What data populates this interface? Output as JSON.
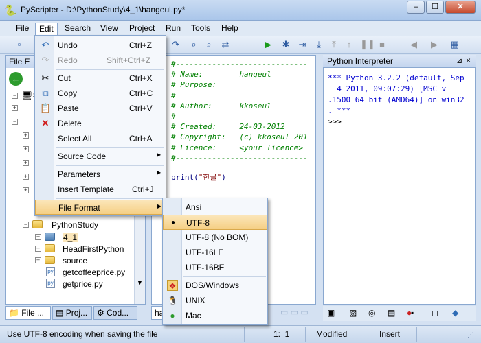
{
  "window": {
    "title": "PyScripter - D:\\PythonStudy\\4_1\\hangeul.py*",
    "min": "–",
    "max": "☐",
    "close": "✕"
  },
  "menubar": [
    "File",
    "Edit",
    "Search",
    "View",
    "Project",
    "Run",
    "Tools",
    "Help"
  ],
  "explorer": {
    "title": "File E",
    "tree_top": "컴",
    "folder": "PythonStudy",
    "items": [
      {
        "label": "4_1",
        "type": "folder"
      },
      {
        "label": "HeadFirstPython",
        "type": "folder"
      },
      {
        "label": "source",
        "type": "folder"
      },
      {
        "label": "getcoffeeprice.py",
        "type": "py"
      },
      {
        "label": "getprice.py",
        "type": "py"
      }
    ]
  },
  "bottom_tabs": [
    "File ...",
    "Proj...",
    "Cod..."
  ],
  "editor": {
    "tab": "han",
    "lines": [
      "#-----------------------------",
      "# Name:        hangeul",
      "# Purpose:",
      "#",
      "# Author:      kkoseul",
      "#",
      "# Created:     24-03-2012",
      "# Copyright:   (c) kkoseul 201",
      "# Licence:     <your licence>",
      "#-----------------------------"
    ],
    "print_kw": "print(",
    "print_str": "\"한글\"",
    "print_end": ")"
  },
  "interpreter": {
    "title": "Python Interpreter",
    "lines": [
      "*** Python 3.2.2 (default, Sep",
      "  4 2011, 09:07:29) [MSC v",
      ".1500 64 bit (AMD64)] on win32",
      ". ***",
      ">>>"
    ]
  },
  "edit_menu": {
    "items": [
      {
        "label": "Undo",
        "shortcut": "Ctrl+Z",
        "icon": "undo-icon",
        "disabled": false
      },
      {
        "label": "Redo",
        "shortcut": "Shift+Ctrl+Z",
        "icon": "redo-icon",
        "disabled": true
      },
      {
        "label": "Cut",
        "shortcut": "Ctrl+X",
        "icon": "cut-icon",
        "disabled": false
      },
      {
        "label": "Copy",
        "shortcut": "Ctrl+C",
        "icon": "copy-icon",
        "disabled": false
      },
      {
        "label": "Paste",
        "shortcut": "Ctrl+V",
        "icon": "paste-icon",
        "disabled": false
      },
      {
        "label": "Delete",
        "shortcut": "",
        "icon": "delete-icon",
        "disabled": false
      },
      {
        "label": "Select All",
        "shortcut": "Ctrl+A",
        "icon": "",
        "disabled": false
      },
      {
        "label": "Source Code",
        "shortcut": "",
        "icon": "",
        "submenu": true
      },
      {
        "label": "Parameters",
        "shortcut": "",
        "icon": "",
        "submenu": true
      },
      {
        "label": "Insert Template",
        "shortcut": "Ctrl+J",
        "icon": ""
      },
      {
        "label": "File Format",
        "shortcut": "",
        "icon": "",
        "submenu": true,
        "highlighted": true
      }
    ]
  },
  "format_menu": {
    "items": [
      {
        "label": "Ansi",
        "checked": false
      },
      {
        "label": "UTF-8",
        "checked": true
      },
      {
        "label": "UTF-8 (No BOM)",
        "checked": false
      },
      {
        "label": "UTF-16LE",
        "checked": false
      },
      {
        "label": "UTF-16BE",
        "checked": false
      },
      {
        "label": "DOS/Windows",
        "icon": "windows-icon"
      },
      {
        "label": "UNIX",
        "icon": "penguin-icon"
      },
      {
        "label": "Mac",
        "icon": "apple-icon"
      }
    ]
  },
  "statusbar": {
    "message": "Use UTF-8 encoding when saving the file",
    "position": "1:  1",
    "modified": "Modified",
    "mode": "Insert"
  }
}
